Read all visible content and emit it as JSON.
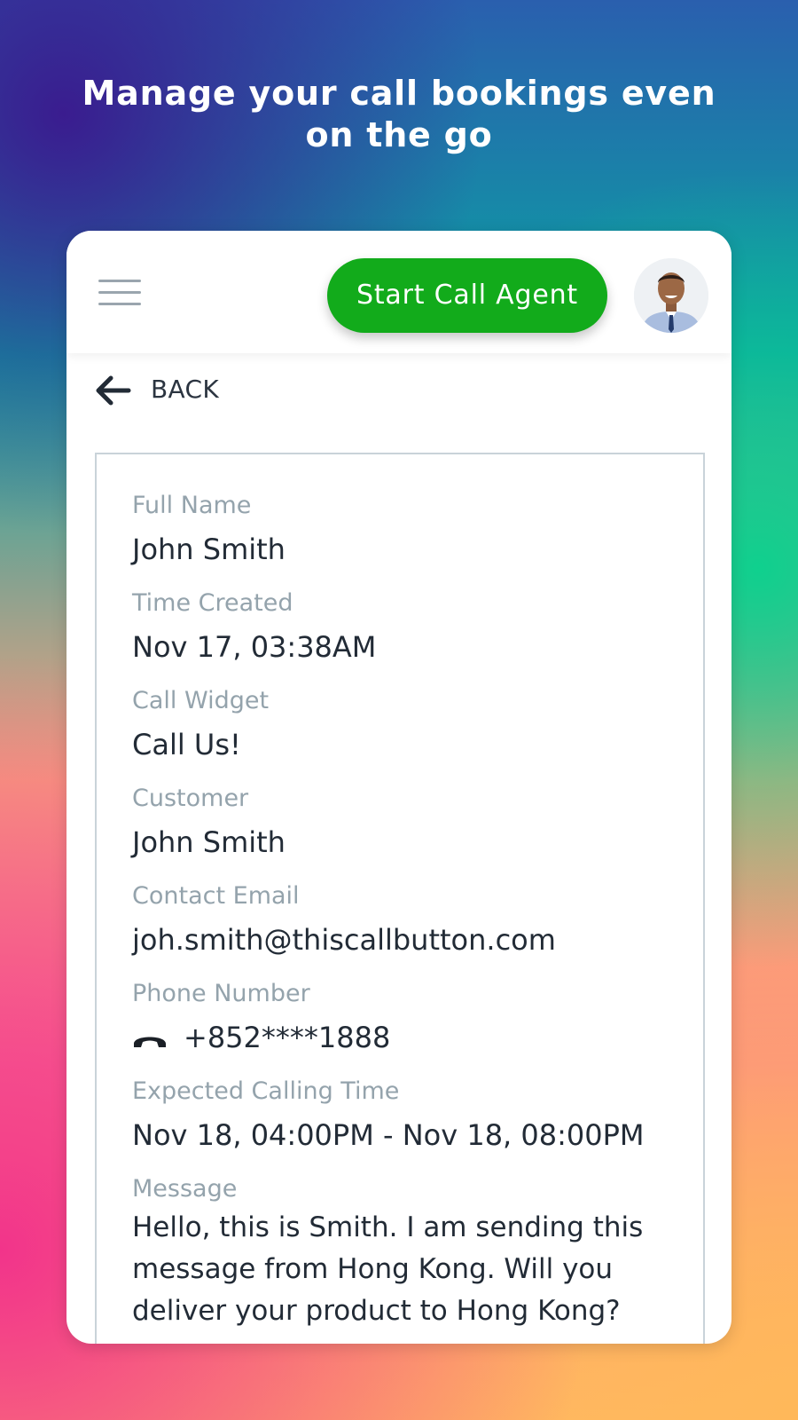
{
  "headline": "Manage your call bookings even on the go",
  "topbar": {
    "menu_icon": "hamburger-menu-icon",
    "start_button_label": "Start Call Agent",
    "avatar_icon": "user-avatar"
  },
  "back": {
    "icon": "arrow-left-icon",
    "label": "BACK"
  },
  "details": {
    "fields": [
      {
        "label": "Full Name",
        "value": "John Smith"
      },
      {
        "label": "Time Created",
        "value": "Nov 17, 03:38AM"
      },
      {
        "label": "Call Widget",
        "value": "Call Us!"
      },
      {
        "label": "Customer",
        "value": "John Smith"
      },
      {
        "label": "Contact Email",
        "value": "joh.smith@thiscallbutton.com"
      },
      {
        "label": "Phone Number",
        "value": "+852****1888",
        "icon": "phone-icon"
      },
      {
        "label": "Expected Calling Time",
        "value": "Nov 18, 04:00PM - Nov 18, 08:00PM"
      },
      {
        "label": "Message",
        "value": "Hello, this is Smith. I am sending this message from Hong Kong. Will you deliver your product to Hong Kong?"
      }
    ]
  },
  "colors": {
    "primary_button": "#12ab1b",
    "label_text": "#94a3ac",
    "value_text": "#222b36"
  }
}
